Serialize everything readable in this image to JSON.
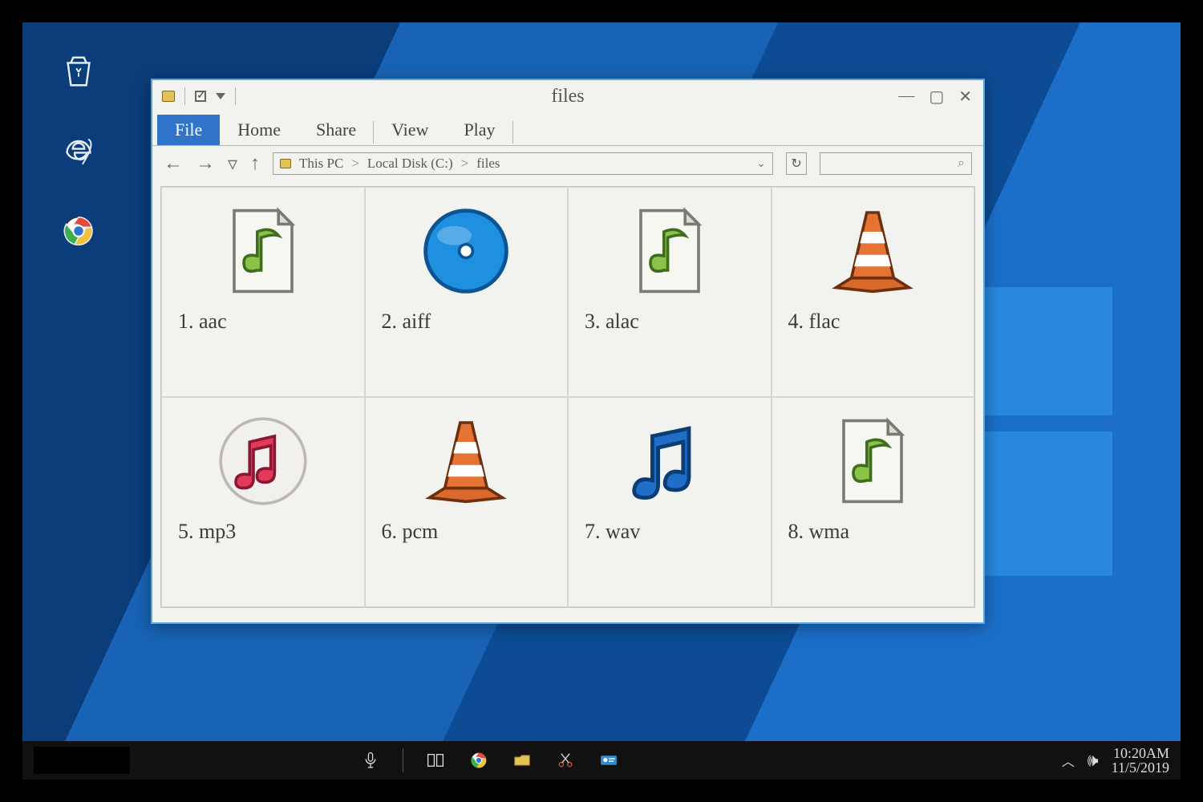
{
  "window": {
    "title": "files",
    "tabs": [
      "File",
      "Home",
      "Share",
      "View",
      "Play"
    ],
    "active_tab": 0,
    "path_crumbs": [
      "This PC",
      "Local Disk (C:)",
      "files"
    ]
  },
  "files": [
    {
      "label": "1. aac",
      "icon": "music-page"
    },
    {
      "label": "2. aiff",
      "icon": "blue-disc"
    },
    {
      "label": "3. alac",
      "icon": "music-page"
    },
    {
      "label": "4. flac",
      "icon": "vlc-cone"
    },
    {
      "label": "5. mp3",
      "icon": "itunes"
    },
    {
      "label": "6. pcm",
      "icon": "vlc-cone"
    },
    {
      "label": "7. wav",
      "icon": "blue-note"
    },
    {
      "label": "8. wma",
      "icon": "music-page"
    }
  ],
  "desktop_icons": [
    {
      "name": "recycle-bin",
      "shape": "recycle"
    },
    {
      "name": "internet-explorer",
      "shape": "ie"
    },
    {
      "name": "chrome",
      "shape": "chrome"
    }
  ],
  "taskbar": {
    "items": [
      "mic",
      "task-view",
      "chrome",
      "folder",
      "snip",
      "contact"
    ],
    "tray": {
      "time": "10:20AM",
      "date": "11/5/2019"
    }
  }
}
